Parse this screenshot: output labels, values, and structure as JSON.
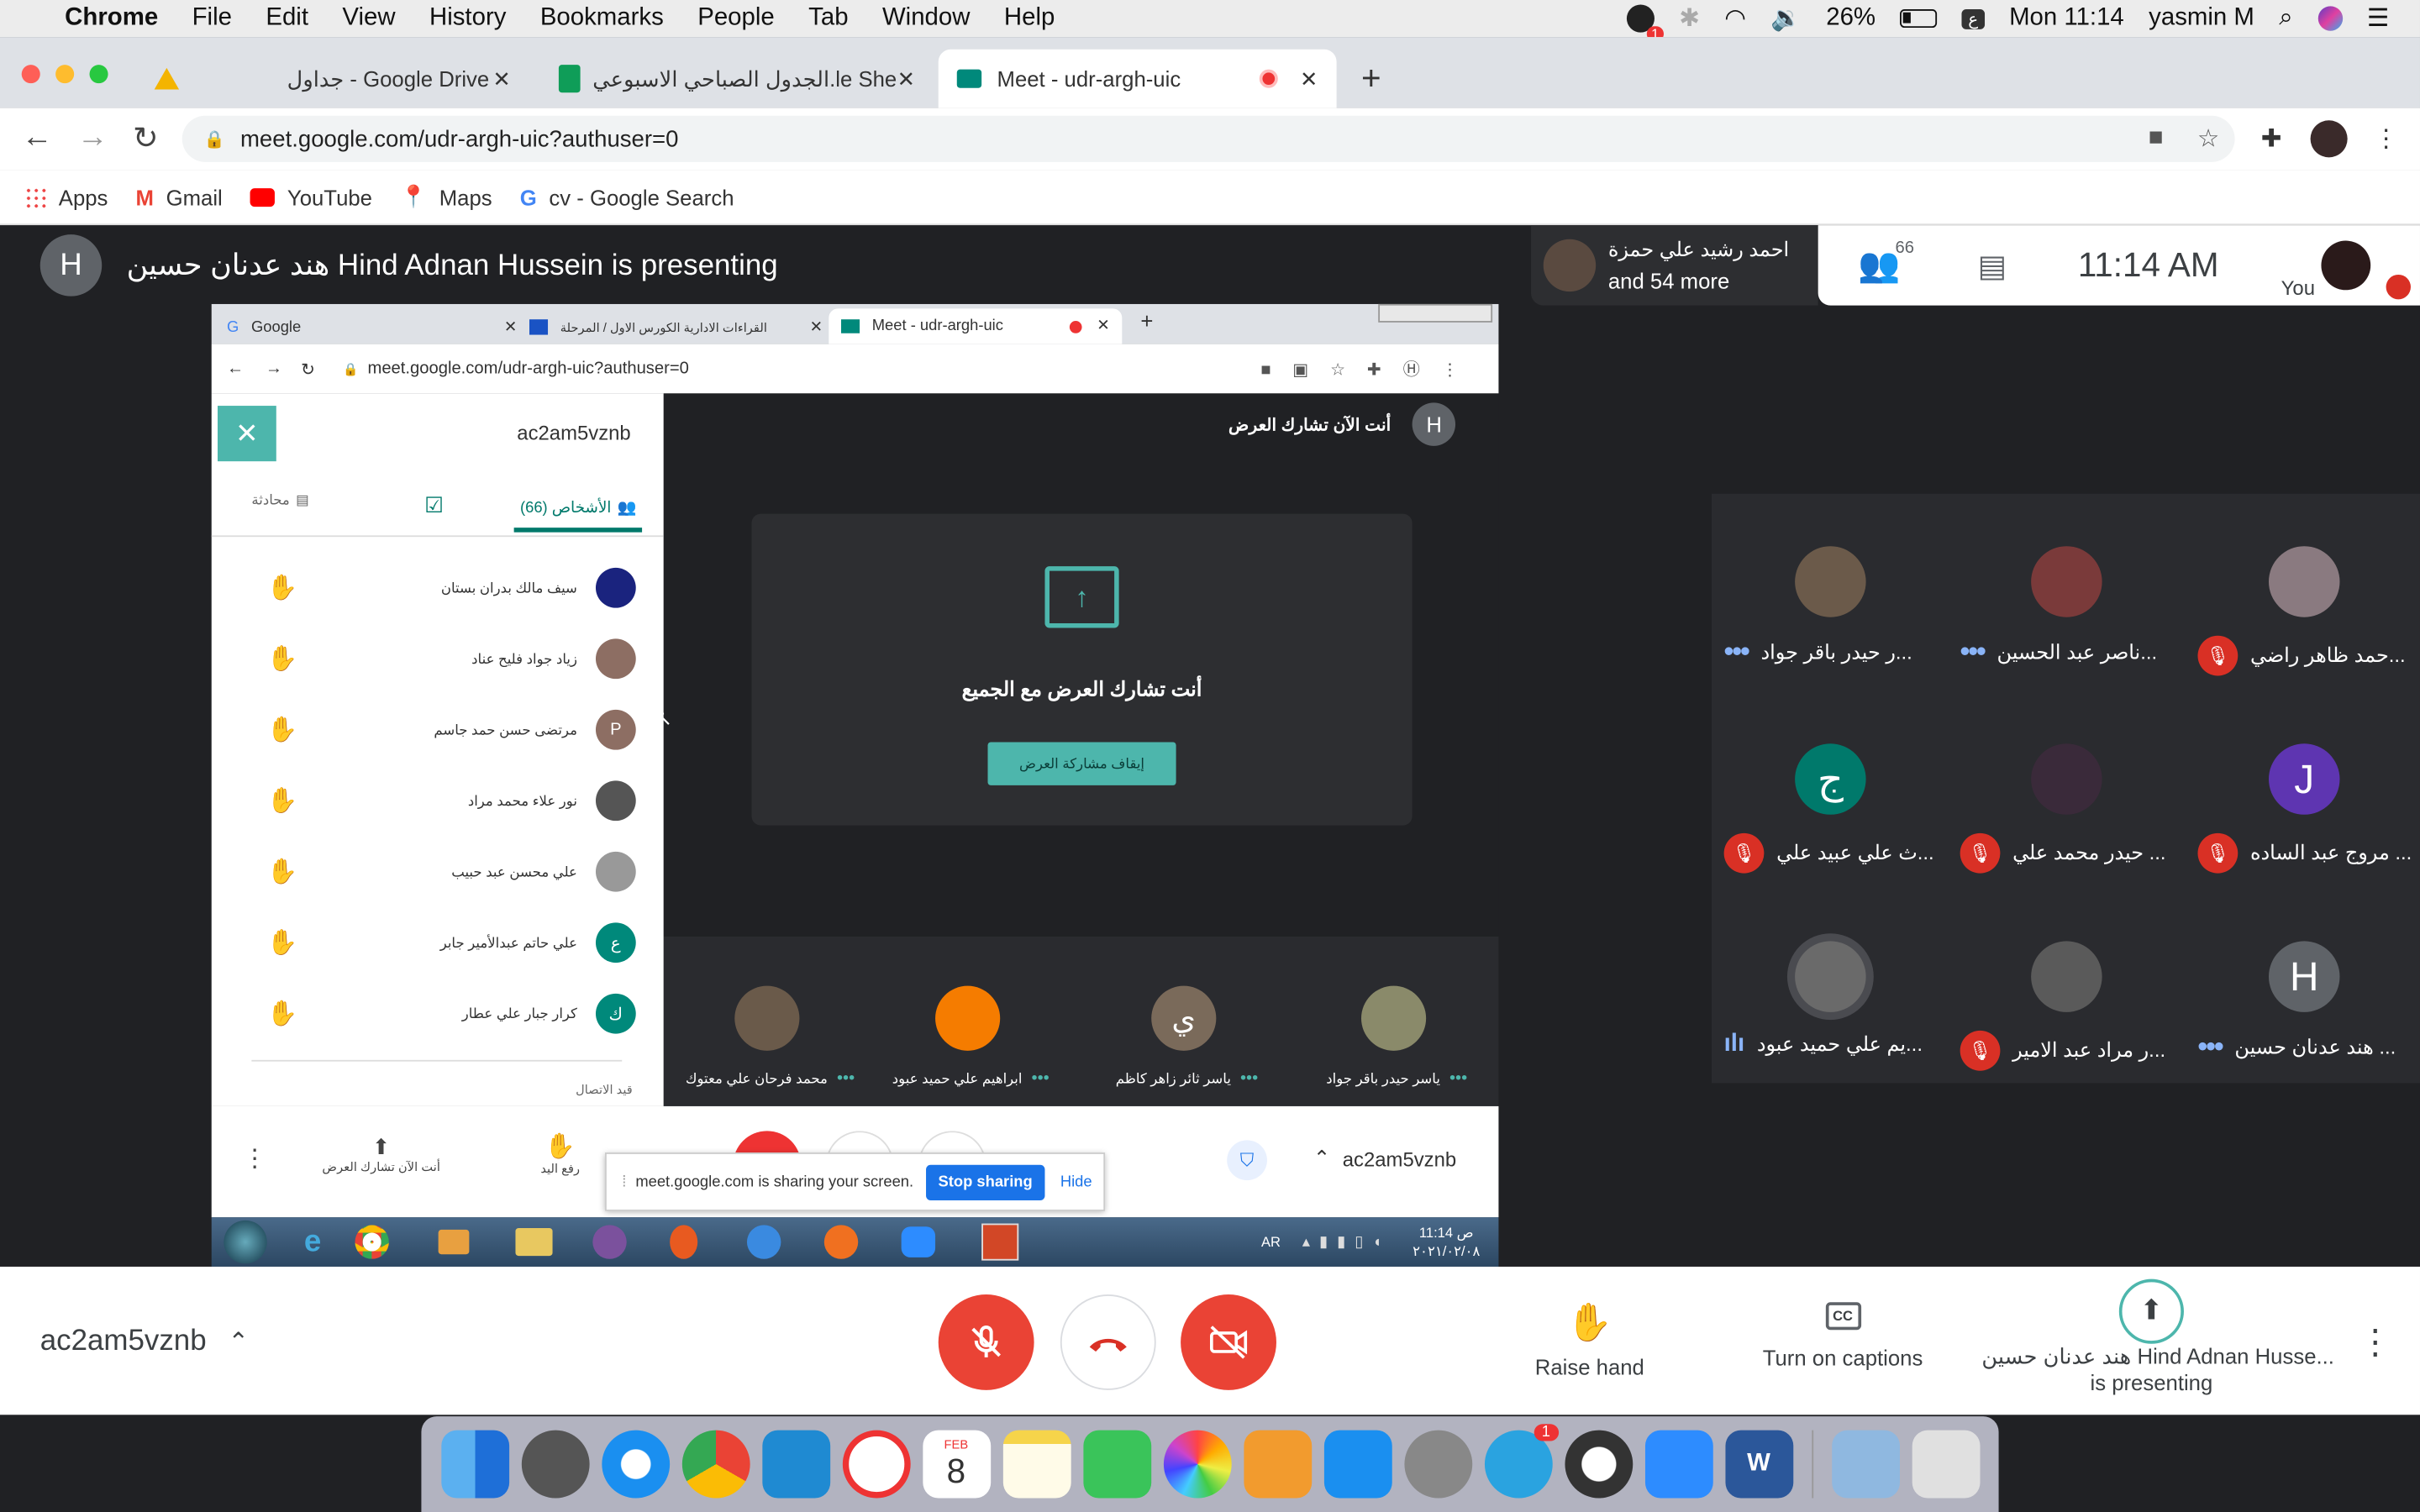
{
  "menubar": {
    "app": "Chrome",
    "menus": [
      "File",
      "Edit",
      "View",
      "History",
      "Bookmarks",
      "People",
      "Tab",
      "Window",
      "Help"
    ],
    "battery": "26%",
    "clock": "Mon 11:14",
    "user": "yasmin M",
    "badge": "1"
  },
  "tabs": [
    {
      "label": "جداول - Google Drive"
    },
    {
      "label": "الجدول الصباحي الاسبوعي.le Sheets"
    },
    {
      "label": "Meet - udr-argh-uic"
    }
  ],
  "omnibox": {
    "url": "meet.google.com/udr-argh-uic?authuser=0"
  },
  "bookmarks": [
    "Apps",
    "Gmail",
    "YouTube",
    "Maps",
    "cv - Google Search"
  ],
  "meet": {
    "presenter_banner": "هند عدنان حسين Hind Adnan Hussein is presenting",
    "presenter_initial": "H",
    "pinned": {
      "name": "احمد رشيد علي حمزة",
      "more": "and 54 more"
    },
    "people_count": "66",
    "clock": "11:14 AM",
    "you_label": "You",
    "tiles": [
      {
        "name": "ر حيدر باقر جواد...",
        "status": "dots"
      },
      {
        "name": "ناصر عبد الحسين...",
        "status": "dots"
      },
      {
        "name": "حمد ظاهر راضي...",
        "status": "muted"
      },
      {
        "name": "ث علي عبيد علي...",
        "status": "muted",
        "initial": "ج"
      },
      {
        "name": "حيدر محمد علي ...",
        "status": "muted"
      },
      {
        "name": "مروج عبد الساده ...",
        "status": "muted",
        "initial": "J"
      },
      {
        "name": "يم علي حميد عبود...",
        "status": "speaking"
      },
      {
        "name": "ر مراد عبد الامير...",
        "status": "muted"
      },
      {
        "name": "هند عدنان حسين ...",
        "status": "dots",
        "initial": "H"
      }
    ]
  },
  "inner": {
    "tabs": [
      "Google",
      "القراءات الادارية الكورس الاول / المرحلة",
      "Meet - udr-argh-uic"
    ],
    "url": "meet.google.com/udr-argh-uic?authuser=0",
    "meeting_code": "ac2am5vznb",
    "panel_tabs": {
      "people": "الأشخاص (66)",
      "chat": "محادثة"
    },
    "people": [
      "سيف مالك بدران بستان",
      "زياد جواد فليح عناد",
      "مرتضى حسن حمد جاسم",
      "نور علاء محمد مراد",
      "علي محسن عبد حبيب",
      "علي حاتم عبدالأمير جابر",
      "كرار جبار علي عطار"
    ],
    "people_initials": [
      "",
      "",
      "P",
      "",
      "",
      "ع",
      "ك"
    ],
    "footer_hint": "قيد الاتصال",
    "presenting_top": "أنت الآن تشارك العرض",
    "presenting_msg": "أنت تشارك العرض مع الجميع",
    "stop_btn": "إيقاف مشاركة العرض",
    "strip": [
      {
        "name": "ياسر حيدر باقر جواد"
      },
      {
        "name": "ياسر ثائر زاهر كاظم",
        "initial": "ي"
      },
      {
        "name": "ابراهيم علي حميد عبود"
      },
      {
        "name": "محمد فرحان علي معتوك"
      }
    ],
    "bottom_present": "أنت الآن تشارك العرض",
    "bottom_raise": "رفع اليد",
    "share_notice": "meet.google.com is sharing your screen.",
    "stop_sharing": "Stop sharing",
    "hide": "Hide",
    "taskbar_lang": "AR",
    "taskbar_time": "11:14 ص",
    "taskbar_date": "٢٠٢١/٠٢/٠٨"
  },
  "bottom": {
    "meeting_code": "ac2am5vznb",
    "raise_hand": "Raise hand",
    "captions": "Turn on captions",
    "presenting_line1": "هند عدنان حسين Hind Adnan Husse...",
    "presenting_line2": "is presenting"
  },
  "dock": {
    "calendar_month": "FEB",
    "calendar_day": "8",
    "telegram_badge": "1"
  },
  "colors": {
    "accent": "#4db6ac",
    "red": "#ea4335",
    "meet_bg": "#202124",
    "tiles_bg": "#2a2b2f"
  }
}
